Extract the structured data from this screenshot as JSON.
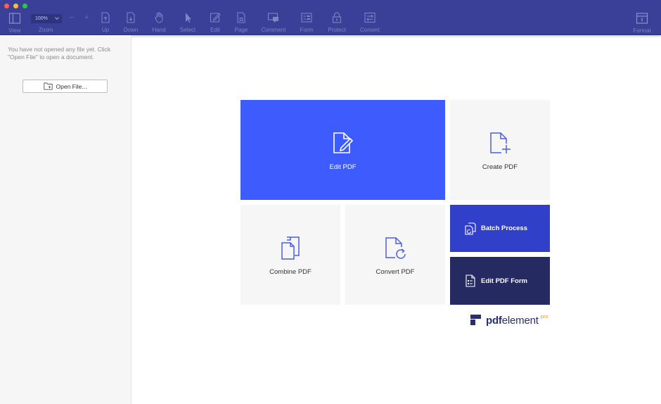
{
  "window": {
    "traffic_lights": [
      "#fe5f57",
      "#ffbd2e",
      "#28c940"
    ]
  },
  "toolbar": {
    "view_label": "View",
    "zoom_value": "100%",
    "zoom_label": "Zoom",
    "minus": "−",
    "plus": "+",
    "up_label": "Up",
    "down_label": "Down",
    "hand_label": "Hand",
    "select_label": "Select",
    "edit_label": "Edit",
    "page_label": "Page",
    "comment_label": "Comment",
    "form_label": "Form",
    "protect_label": "Protect",
    "convert_label": "Convert",
    "format_label": "Format"
  },
  "sidebar": {
    "message": "You have not opened any file yet. Click \"Open File\" to open a document.",
    "open_button": "Open File..."
  },
  "tiles": {
    "edit_pdf": "Edit PDF",
    "create_pdf": "Create PDF",
    "combine_pdf": "Combine PDF",
    "convert_pdf": "Convert PDF",
    "batch_process": "Batch Process",
    "edit_pdf_form": "Edit PDF Form"
  },
  "brand": {
    "bold": "pdf",
    "rest": "element",
    "edition": "pro"
  },
  "colors": {
    "toolbar_bg": "#3a3f97",
    "edit_tile": "#3e5bfd",
    "batch_tile": "#3140c9",
    "form_tile": "#252b61",
    "light_tile": "#f6f6f6",
    "icon_blue": "#4a5fd6",
    "brand_orange": "#f39a26"
  }
}
